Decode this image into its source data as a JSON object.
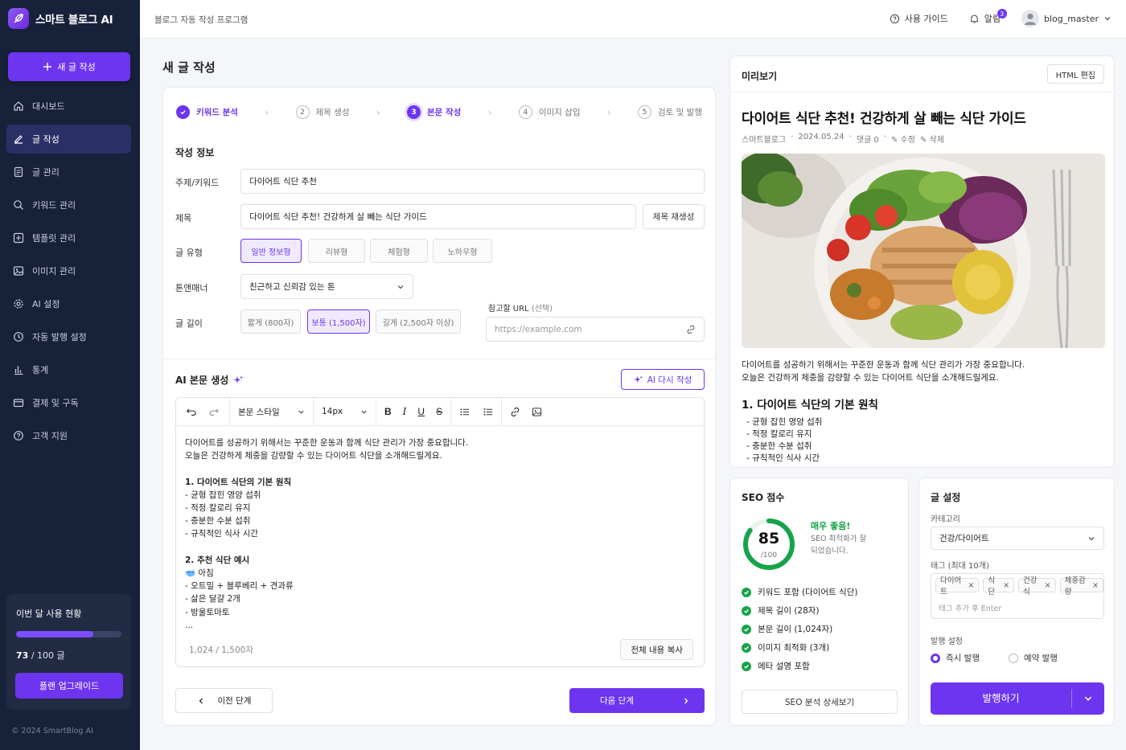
{
  "app": {
    "name": "스마트 블로그 AI",
    "copyright": "© 2024 SmartBlog AI"
  },
  "sidebar": {
    "new_post_label": "새 글 작성",
    "items": [
      {
        "label": "대시보드",
        "icon": "home-icon"
      },
      {
        "label": "글 작성",
        "icon": "edit-icon",
        "active": true
      },
      {
        "label": "글 관리",
        "icon": "document-icon"
      },
      {
        "label": "키워드 관리",
        "icon": "search-icon"
      },
      {
        "label": "템플릿 관리",
        "icon": "template-icon"
      },
      {
        "label": "이미지 관리",
        "icon": "image-icon"
      },
      {
        "label": "AI 설정",
        "icon": "gear-icon"
      },
      {
        "label": "자동 발행 설정",
        "icon": "clock-icon"
      },
      {
        "label": "통계",
        "icon": "bar-chart-icon"
      },
      {
        "label": "결제 및 구독",
        "icon": "card-icon"
      },
      {
        "label": "고객 지원",
        "icon": "help-icon"
      }
    ],
    "usage": {
      "title": "이번 달 사용 현황",
      "used": "73",
      "total": "/ 100 글",
      "fraction": 0.73,
      "upgrade_label": "플랜 업그레이드"
    }
  },
  "topbar": {
    "breadcrumb": "블로그 자동 작성 프로그램",
    "guide_label": "사용 가이드",
    "notif_label": "알림",
    "notif_count": "3",
    "username": "blog_master"
  },
  "page_title": "새 글 작성",
  "steps": [
    {
      "num": "1",
      "label": "키워드 분석",
      "state": "done"
    },
    {
      "num": "2",
      "label": "제목 생성",
      "state": "todo"
    },
    {
      "num": "3",
      "label": "본문 작성",
      "state": "current"
    },
    {
      "num": "4",
      "label": "이미지 삽입",
      "state": "todo"
    },
    {
      "num": "5",
      "label": "검토 및 발행",
      "state": "todo"
    }
  ],
  "form": {
    "section_title": "작성 정보",
    "topic_label": "주제/키워드",
    "topic_value": "다이어트 식단 추천",
    "title_label": "제목",
    "title_value": "다이어트 식단 추천! 건강하게 살 빼는 식단 가이드",
    "regen_title_label": "제목 재생성",
    "type_label": "글 유형",
    "types": [
      "일반 정보형",
      "리뷰형",
      "체험형",
      "노하우형"
    ],
    "tone_label": "톤앤매너",
    "tone_value": "친근하고 신뢰감 있는 톤",
    "length_label": "글 길이",
    "lengths": [
      "짧게 (800자)",
      "보통 (1,500자)",
      "길게 (2,500자 이상)"
    ],
    "ref_label": "참고할 URL",
    "ref_optional": "(선택)",
    "ref_placeholder": "https://example.com"
  },
  "ai": {
    "section_title": "AI 본문 생성",
    "regen_label": "AI 다시 작성",
    "toolbar": {
      "style": "본문 스타일",
      "size": "14px"
    },
    "body_lines": [
      {
        "t": "다이어트를 성공하기 위해서는 꾸준한 운동과 함께 식단 관리가 가장 중요합니다.",
        "b": false
      },
      {
        "t": "오늘은 건강하게 체중을 감량할 수 있는 다이어트 식단을 소개해드릴게요.",
        "b": false
      },
      {
        "t": "",
        "b": false
      },
      {
        "t": "1. 다이어트 식단의 기본 원칙",
        "b": true
      },
      {
        "t": "- 균형 잡힌 영양 섭취",
        "b": false
      },
      {
        "t": "- 적정 칼로리 유지",
        "b": false
      },
      {
        "t": "- 충분한 수분 섭취",
        "b": false
      },
      {
        "t": "- 규칙적인 식사 시간",
        "b": false
      },
      {
        "t": "",
        "b": false
      },
      {
        "t": "2. 추천 식단 예시",
        "b": true
      },
      {
        "t": "🥣 아침",
        "b": false
      },
      {
        "t": "- 오트밀 + 블루베리 + 견과류",
        "b": false
      },
      {
        "t": "- 삶은 달걀 2개",
        "b": false
      },
      {
        "t": "- 방울토마토",
        "b": false
      },
      {
        "t": "...",
        "b": false
      }
    ],
    "char_count": "1,024 / 1,500자",
    "copy_label": "전체 내용 복사"
  },
  "nav_buttons": {
    "prev": "이전 단계",
    "next": "다음 단계"
  },
  "preview": {
    "heading": "미리보기",
    "html_edit": "HTML 편집",
    "title": "다이어트 식단 추천! 건강하게 살 빼는 식단 가이드",
    "author": "스마트블로그",
    "date": "2024.05.24",
    "comments": "댓글 0",
    "edit": "수정",
    "delete": "삭제",
    "intro1": "다이어트를 성공하기 위해서는 꾸준한 운동과 함께 식단 관리가 가장 중요합니다.",
    "intro2": "오늘은 건강하게 체중을 감량할 수 있는 다이어트 식단을 소개해드릴게요.",
    "h1": "1. 다이어트 식단의 기본 원칙",
    "list": [
      "- 균형 잡힌 영양 섭취",
      "- 적정 칼로리 유지",
      "- 충분한 수분 섭취",
      "- 규칙적인 식사 시간"
    ]
  },
  "seo": {
    "heading": "SEO 점수",
    "score": "85",
    "score_den": "/100",
    "score_fraction": 0.85,
    "verdict": "매우 좋음!",
    "desc1": "SEO 최적화가 잘",
    "desc2": "되었습니다.",
    "checks": [
      "키워드 포함 (다이어트 식단)",
      "제목 길이 (28자)",
      "본문 길이 (1,024자)",
      "이미지 최적화 (3개)",
      "메타 설명 포함"
    ],
    "detail_label": "SEO 분석 상세보기"
  },
  "settings": {
    "heading": "글 설정",
    "category_label": "카테고리",
    "category_value": "건강/다이어트",
    "tags_label": "태그 (최대 10개)",
    "tags": [
      "다이어트",
      "식단",
      "건강식",
      "체중감량"
    ],
    "tag_placeholder": "태그 추가 후 Enter",
    "publish_label": "발행 설정",
    "publish_options": [
      "즉시 발행",
      "예약 발행"
    ],
    "publish_button": "발행하기"
  },
  "colors": {
    "accent": "#6d35f0",
    "sidebar": "#17213a",
    "success": "#16a34a"
  }
}
